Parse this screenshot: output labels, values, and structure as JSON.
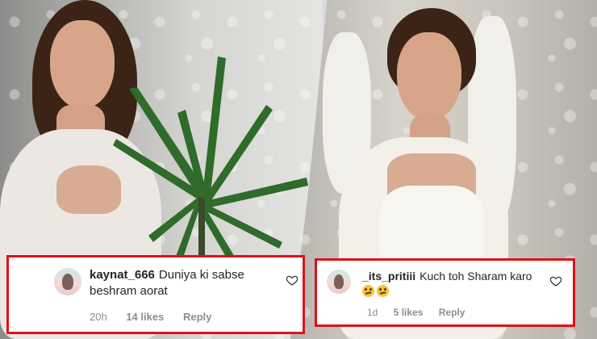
{
  "comments": [
    {
      "username": "kaynat_666",
      "text": "Duniya ki sabse beshram aorat",
      "time": "20h",
      "likes": "14 likes",
      "reply": "Reply",
      "like_icon": "heart-outline-icon"
    },
    {
      "username": "_its_pritiii",
      "text": "Kuch toh Sharam karo",
      "emojis": [
        "thinking-face-emoji",
        "thinking-face-emoji"
      ],
      "time": "1d",
      "likes": "5 likes",
      "reply": "Reply",
      "like_icon": "heart-outline-icon"
    }
  ],
  "colors": {
    "highlight_border": "#e0101c",
    "comment_bg": "#ffffff",
    "meta_text": "#8e8e8e"
  }
}
